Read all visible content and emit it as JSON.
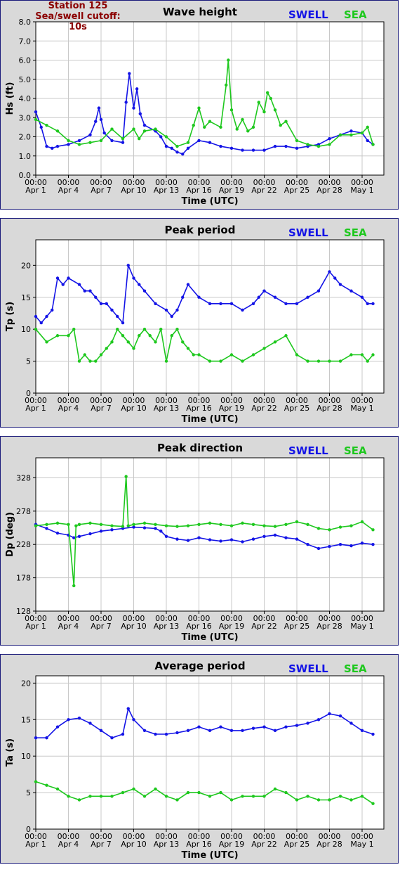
{
  "station": {
    "title": "Station 125",
    "cutoff": "Sea/swell cutoff: 10s"
  },
  "legend": {
    "swell": "SWELL",
    "sea": "SEA"
  },
  "colors": {
    "swell": "#1414e6",
    "sea": "#1ec81e",
    "station": "#8b0000",
    "panel_bg": "#d9d9d9",
    "grid": "#c8c8c8"
  },
  "x_axis": {
    "label": "Time (UTC)",
    "range_days": [
      0,
      32
    ],
    "ticks": [
      {
        "day": 0,
        "time": "00:00",
        "date": "Apr 1"
      },
      {
        "day": 3,
        "time": "00:00",
        "date": "Apr 4"
      },
      {
        "day": 6,
        "time": "00:00",
        "date": "Apr 7"
      },
      {
        "day": 9,
        "time": "00:00",
        "date": "Apr 10"
      },
      {
        "day": 12,
        "time": "00:00",
        "date": "Apr 13"
      },
      {
        "day": 15,
        "time": "00:00",
        "date": "Apr 16"
      },
      {
        "day": 18,
        "time": "00:00",
        "date": "Apr 19"
      },
      {
        "day": 21,
        "time": "00:00",
        "date": "Apr 22"
      },
      {
        "day": 24,
        "time": "00:00",
        "date": "Apr 25"
      },
      {
        "day": 27,
        "time": "00:00",
        "date": "Apr 28"
      },
      {
        "day": 30,
        "time": "00:00",
        "date": "May 1"
      }
    ]
  },
  "chart_data": [
    {
      "type": "line",
      "title": "Wave height",
      "ylabel": "Hs (ft)",
      "ylim": [
        0,
        8
      ],
      "yticks": [
        "0.0",
        "1.0",
        "2.0",
        "3.0",
        "4.0",
        "5.0",
        "6.0",
        "7.0",
        "8.0"
      ],
      "grid": true,
      "x_unit": "days since Apr 1 00:00",
      "series": [
        {
          "name": "SWELL",
          "x": [
            0,
            0.5,
            1,
            1.5,
            2,
            3,
            4,
            5,
            5.5,
            5.8,
            6,
            6.3,
            7,
            8,
            8.3,
            8.6,
            9,
            9.3,
            9.6,
            10,
            11,
            11.5,
            12,
            12.5,
            13,
            13.5,
            14,
            15,
            16,
            17,
            18,
            19,
            20,
            21,
            22,
            23,
            24,
            25,
            26,
            27,
            28,
            29,
            30,
            30.5,
            31
          ],
          "values": [
            3.3,
            2.5,
            1.5,
            1.4,
            1.5,
            1.6,
            1.8,
            2.1,
            2.8,
            3.5,
            2.9,
            2.2,
            1.8,
            1.7,
            3.8,
            5.3,
            3.5,
            4.5,
            3.2,
            2.6,
            2.3,
            2.0,
            1.5,
            1.4,
            1.2,
            1.1,
            1.4,
            1.8,
            1.7,
            1.5,
            1.4,
            1.3,
            1.3,
            1.3,
            1.5,
            1.5,
            1.4,
            1.5,
            1.6,
            1.9,
            2.1,
            2.3,
            2.2,
            1.8,
            1.6
          ]
        },
        {
          "name": "SEA",
          "x": [
            0,
            1,
            2,
            3,
            4,
            5,
            6,
            7,
            8,
            9,
            9.5,
            10,
            11,
            12,
            13,
            14,
            14.5,
            15,
            15.5,
            16,
            17,
            17.5,
            17.7,
            18,
            18.5,
            19,
            19.5,
            20,
            20.5,
            21,
            21.3,
            21.6,
            22,
            22.5,
            23,
            24,
            25,
            26,
            27,
            28,
            29,
            30,
            30.5,
            31
          ],
          "values": [
            2.9,
            2.6,
            2.3,
            1.8,
            1.6,
            1.7,
            1.8,
            2.4,
            1.9,
            2.4,
            1.9,
            2.3,
            2.4,
            2.0,
            1.5,
            1.7,
            2.6,
            3.5,
            2.5,
            2.8,
            2.5,
            4.7,
            6.0,
            3.4,
            2.4,
            2.9,
            2.3,
            2.5,
            3.8,
            3.3,
            4.3,
            4.0,
            3.4,
            2.6,
            2.8,
            1.8,
            1.6,
            1.5,
            1.6,
            2.1,
            2.1,
            2.2,
            2.5,
            1.6
          ]
        }
      ]
    },
    {
      "type": "scatter",
      "title": "Peak period",
      "ylabel": "Tp (s)",
      "ylim": [
        0,
        24
      ],
      "yticks": [
        "0",
        "5",
        "10",
        "15",
        "20"
      ],
      "grid": true,
      "x_unit": "days since Apr 1 00:00",
      "series": [
        {
          "name": "SWELL",
          "x": [
            0,
            0.5,
            1,
            1.5,
            2,
            2.5,
            3,
            4,
            4.5,
            5,
            5.5,
            6,
            6.5,
            7,
            7.5,
            8,
            8.5,
            9,
            9.5,
            10,
            11,
            12,
            12.5,
            13,
            13.5,
            14,
            15,
            16,
            17,
            18,
            19,
            20,
            20.5,
            21,
            22,
            23,
            24,
            25,
            26,
            27,
            27.5,
            28,
            29,
            30,
            30.5,
            31
          ],
          "values": [
            12,
            11,
            12,
            13,
            18,
            17,
            18,
            17,
            16,
            16,
            15,
            14,
            14,
            13,
            12,
            11,
            20,
            18,
            17,
            16,
            14,
            13,
            12,
            13,
            15,
            17,
            15,
            14,
            14,
            14,
            13,
            14,
            15,
            16,
            15,
            14,
            14,
            15,
            16,
            19,
            18,
            17,
            16,
            15,
            14,
            14
          ]
        },
        {
          "name": "SEA",
          "x": [
            0,
            1,
            2,
            3,
            3.5,
            4,
            4.5,
            5,
            5.5,
            6,
            6.5,
            7,
            7.5,
            8,
            8.5,
            9,
            9.5,
            10,
            10.5,
            11,
            11.5,
            12,
            12.5,
            13,
            13.5,
            14,
            14.5,
            15,
            16,
            17,
            18,
            19,
            20,
            21,
            22,
            23,
            24,
            25,
            26,
            27,
            28,
            29,
            30,
            30.5,
            31
          ],
          "values": [
            10,
            8,
            9,
            9,
            10,
            5,
            6,
            5,
            5,
            6,
            7,
            8,
            10,
            9,
            8,
            7,
            9,
            10,
            9,
            8,
            10,
            5,
            9,
            10,
            8,
            7,
            6,
            6,
            5,
            5,
            6,
            5,
            6,
            7,
            8,
            9,
            6,
            5,
            5,
            5,
            5,
            6,
            6,
            5,
            6
          ]
        }
      ]
    },
    {
      "type": "scatter",
      "title": "Peak direction",
      "ylabel": "Dp (deg)",
      "ylim": [
        128,
        358
      ],
      "yticks": [
        "128",
        "178",
        "228",
        "278",
        "328"
      ],
      "grid": true,
      "x_unit": "days since Apr 1 00:00",
      "series": [
        {
          "name": "SWELL",
          "x": [
            0,
            1,
            2,
            3,
            3.5,
            4,
            5,
            6,
            7,
            8,
            9,
            10,
            11,
            11.5,
            12,
            13,
            14,
            15,
            16,
            17,
            18,
            19,
            20,
            21,
            22,
            23,
            24,
            25,
            26,
            27,
            28,
            29,
            30,
            31
          ],
          "values": [
            258,
            252,
            245,
            242,
            238,
            240,
            244,
            248,
            250,
            252,
            254,
            253,
            252,
            248,
            240,
            236,
            234,
            238,
            235,
            233,
            235,
            232,
            236,
            240,
            242,
            238,
            236,
            228,
            222,
            225,
            228,
            226,
            230,
            228
          ]
        },
        {
          "name": "SEA",
          "x": [
            0,
            1,
            2,
            3,
            3.5,
            3.7,
            4,
            5,
            6,
            7,
            8,
            8.3,
            8.5,
            9,
            10,
            11,
            12,
            13,
            14,
            15,
            16,
            17,
            18,
            19,
            20,
            21,
            22,
            23,
            24,
            25,
            26,
            27,
            28,
            29,
            30,
            31
          ],
          "values": [
            256,
            258,
            260,
            258,
            166,
            256,
            258,
            260,
            258,
            256,
            255,
            330,
            256,
            258,
            260,
            258,
            256,
            255,
            256,
            258,
            260,
            258,
            256,
            260,
            258,
            256,
            255,
            258,
            262,
            258,
            252,
            250,
            254,
            256,
            262,
            250
          ]
        }
      ]
    },
    {
      "type": "line",
      "title": "Average period",
      "ylabel": "Ta (s)",
      "ylim": [
        0,
        21
      ],
      "yticks": [
        "0",
        "5",
        "10",
        "15",
        "20"
      ],
      "grid": true,
      "x_unit": "days since Apr 1 00:00",
      "series": [
        {
          "name": "SWELL",
          "x": [
            0,
            1,
            2,
            3,
            4,
            5,
            6,
            7,
            8,
            8.5,
            9,
            10,
            11,
            12,
            13,
            14,
            15,
            16,
            17,
            18,
            19,
            20,
            21,
            22,
            23,
            24,
            25,
            26,
            27,
            28,
            29,
            30,
            31
          ],
          "values": [
            12.5,
            12.5,
            14,
            15,
            15.2,
            14.5,
            13.5,
            12.5,
            13,
            16.5,
            15,
            13.5,
            13,
            13,
            13.2,
            13.5,
            14,
            13.5,
            14,
            13.5,
            13.5,
            13.8,
            14,
            13.5,
            14,
            14.2,
            14.5,
            15,
            15.8,
            15.5,
            14.5,
            13.5,
            13
          ]
        },
        {
          "name": "SEA",
          "x": [
            0,
            1,
            2,
            3,
            4,
            5,
            6,
            7,
            8,
            9,
            10,
            11,
            12,
            13,
            14,
            15,
            16,
            17,
            18,
            19,
            20,
            21,
            22,
            23,
            24,
            25,
            26,
            27,
            28,
            29,
            30,
            31
          ],
          "values": [
            6.5,
            6,
            5.5,
            4.5,
            4,
            4.5,
            4.5,
            4.5,
            5,
            5.5,
            4.5,
            5.5,
            4.5,
            4,
            5,
            5,
            4.5,
            5,
            4,
            4.5,
            4.5,
            4.5,
            5.5,
            5,
            4,
            4.5,
            4,
            4,
            4.5,
            4,
            4.5,
            3.5
          ]
        }
      ]
    }
  ]
}
